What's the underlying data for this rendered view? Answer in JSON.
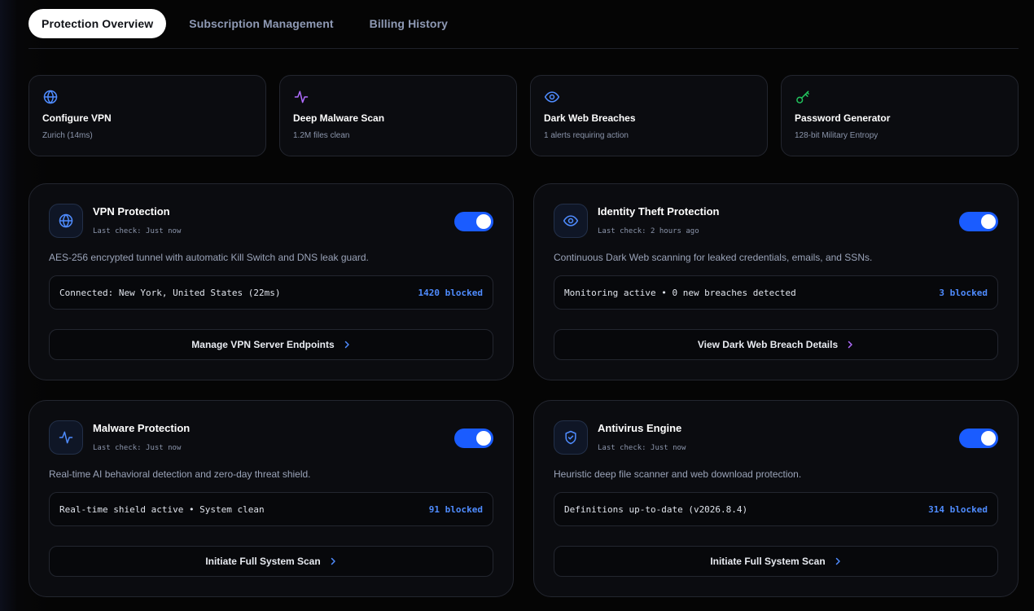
{
  "tabs": [
    {
      "label": "Protection Overview",
      "active": true
    },
    {
      "label": "Subscription Management",
      "active": false
    },
    {
      "label": "Billing History",
      "active": false
    }
  ],
  "quick_actions": [
    {
      "icon": "globe-icon",
      "title": "Configure VPN",
      "subtitle": "Zurich (14ms)",
      "color": "#4f8cff"
    },
    {
      "icon": "activity-icon",
      "title": "Deep Malware Scan",
      "subtitle": "1.2M files clean",
      "color": "#b06cff"
    },
    {
      "icon": "eye-icon",
      "title": "Dark Web Breaches",
      "subtitle": "1 alerts requiring action",
      "color": "#4f8cff"
    },
    {
      "icon": "key-icon",
      "title": "Password Generator",
      "subtitle": "128-bit Military Entropy",
      "color": "#22c55e"
    }
  ],
  "cards": [
    {
      "icon": "globe-icon",
      "title": "VPN Protection",
      "last_check": "Last check: Just now",
      "enabled": true,
      "description": "AES-256 encrypted tunnel with automatic Kill Switch and DNS leak guard.",
      "status_text": "Connected: New York, United States (22ms)",
      "blocked": "1420 blocked",
      "action_label": "Manage VPN Server Endpoints",
      "chevron_color": "#4f8cff"
    },
    {
      "icon": "eye-icon",
      "title": "Identity Theft Protection",
      "last_check": "Last check: 2 hours ago",
      "enabled": true,
      "description": "Continuous Dark Web scanning for leaked credentials, emails, and SSNs.",
      "status_text": "Monitoring active • 0 new breaches detected",
      "blocked": "3 blocked",
      "action_label": "View Dark Web Breach Details",
      "chevron_color": "#b06cff"
    },
    {
      "icon": "activity-icon",
      "title": "Malware Protection",
      "last_check": "Last check: Just now",
      "enabled": true,
      "description": "Real-time AI behavioral detection and zero-day threat shield.",
      "status_text": "Real-time shield active • System clean",
      "blocked": "91 blocked",
      "action_label": "Initiate Full System Scan",
      "chevron_color": "#4f8cff"
    },
    {
      "icon": "shield-check-icon",
      "title": "Antivirus Engine",
      "last_check": "Last check: Just now",
      "enabled": true,
      "description": "Heuristic deep file scanner and web download protection.",
      "status_text": "Definitions up-to-date (v2026.8.4)",
      "blocked": "314 blocked",
      "action_label": "Initiate Full System Scan",
      "chevron_color": "#4f8cff"
    }
  ],
  "colors": {
    "accent": "#1a5cff",
    "blocked_text": "#4f8cff",
    "background": "#050505"
  }
}
